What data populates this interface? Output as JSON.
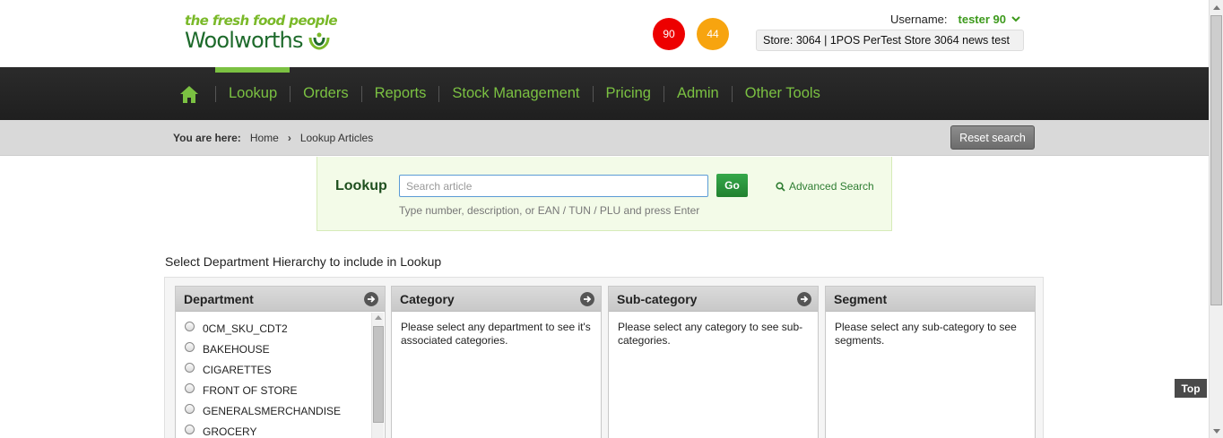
{
  "header": {
    "tagline": "the fresh food people",
    "brand": "Woolworths",
    "badges": [
      {
        "value": "90",
        "color": "#ed0000"
      },
      {
        "value": "44",
        "color": "#f7a40f"
      }
    ],
    "username_label": "Username:",
    "username": "tester 90",
    "store": "Store: 3064 | 1POS PerTest Store 3064 news test"
  },
  "nav": {
    "home_icon": "home-icon",
    "items": [
      "Lookup",
      "Orders",
      "Reports",
      "Stock Management",
      "Pricing",
      "Admin",
      "Other Tools"
    ],
    "active": "Lookup",
    "accent": "#7bc142"
  },
  "breadcrumb": {
    "label": "You are here:",
    "items": [
      "Home",
      "Lookup Articles"
    ],
    "reset_label": "Reset search"
  },
  "lookup": {
    "title": "Lookup",
    "placeholder": "Search article",
    "go_label": "Go",
    "advanced_label": "Advanced Search",
    "hint": "Type number, description, or EAN / TUN / PLU and press Enter"
  },
  "hierarchy": {
    "title": "Select Department Hierarchy to include in Lookup",
    "columns": [
      {
        "header": "Department",
        "items": [
          "0CM_SKU_CDT2",
          "BAKEHOUSE",
          "CIGARETTES",
          "FRONT OF STORE",
          "GENERALSMERCHANDISE",
          "GROCERY"
        ]
      },
      {
        "header": "Category",
        "message": "Please select any department to see it's associated categories."
      },
      {
        "header": "Sub-category",
        "message": "Please select any category to see sub-categories."
      },
      {
        "header": "Segment",
        "message": "Please select any sub-category to see segments."
      }
    ]
  },
  "top_button": "Top"
}
